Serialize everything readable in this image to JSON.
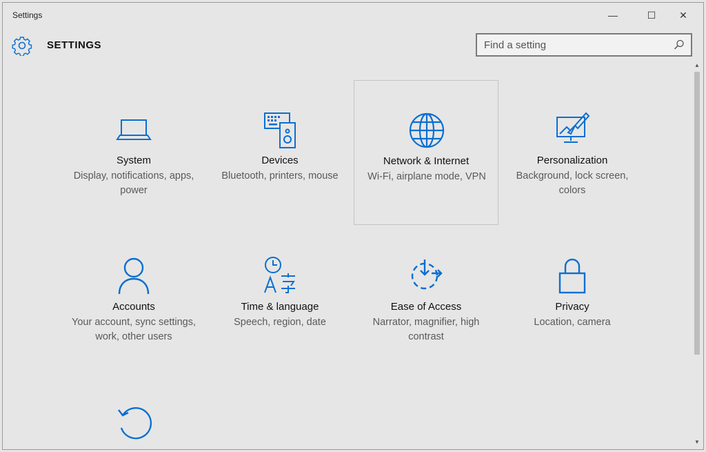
{
  "window": {
    "title": "Settings",
    "minimize_glyph": "—",
    "maximize_glyph": "☐",
    "close_glyph": "✕"
  },
  "header": {
    "title": "SETTINGS",
    "icon": "gear-icon"
  },
  "search": {
    "placeholder": "Find a setting",
    "value": "",
    "icon": "search-icon"
  },
  "colors": {
    "accent": "#0a6fd1",
    "background": "#e6e6e6",
    "secondary_text": "#5a5a5a"
  },
  "categories": [
    {
      "name": "System",
      "description": "Display, notifications, apps, power",
      "icon": "laptop-icon"
    },
    {
      "name": "Devices",
      "description": "Bluetooth, printers, mouse",
      "icon": "devices-icon"
    },
    {
      "name": "Network & Internet",
      "description": "Wi-Fi, airplane mode, VPN",
      "icon": "globe-icon",
      "hovered": true
    },
    {
      "name": "Personalization",
      "description": "Background, lock screen, colors",
      "icon": "personalization-icon"
    },
    {
      "name": "Accounts",
      "description": "Your account, sync settings, work, other users",
      "icon": "person-icon"
    },
    {
      "name": "Time & language",
      "description": "Speech, region, date",
      "icon": "time-language-icon"
    },
    {
      "name": "Ease of Access",
      "description": "Narrator, magnifier, high contrast",
      "icon": "ease-of-access-icon"
    },
    {
      "name": "Privacy",
      "description": "Location, camera",
      "icon": "lock-icon"
    },
    {
      "name": "",
      "description": "",
      "icon": "update-security-icon"
    }
  ]
}
